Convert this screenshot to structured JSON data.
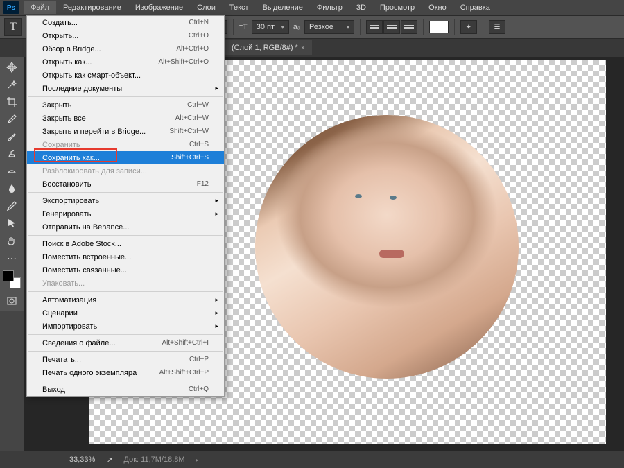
{
  "app": {
    "logo": "Ps"
  },
  "menubar": {
    "items": [
      "Файл",
      "Редактирование",
      "Изображение",
      "Слои",
      "Текст",
      "Выделение",
      "Фильтр",
      "3D",
      "Просмотр",
      "Окно",
      "Справка"
    ],
    "activeIndex": 0
  },
  "optionsbar": {
    "tool_glyph": "T",
    "font_size": "30 пт",
    "font_size_icon": "тТ",
    "aa_icon": "aₐ",
    "antialias": "Резкое",
    "color_swatch": "#ffffff"
  },
  "tab": {
    "label": "(Слой 1, RGB/8#) *"
  },
  "file_menu": {
    "groups": [
      [
        {
          "label": "Создать...",
          "shortcut": "Ctrl+N",
          "disabled": false
        },
        {
          "label": "Открыть...",
          "shortcut": "Ctrl+O",
          "disabled": false
        },
        {
          "label": "Обзор в Bridge...",
          "shortcut": "Alt+Ctrl+O",
          "disabled": false
        },
        {
          "label": "Открыть как...",
          "shortcut": "Alt+Shift+Ctrl+O",
          "disabled": false
        },
        {
          "label": "Открыть как смарт-объект...",
          "shortcut": "",
          "disabled": false
        },
        {
          "label": "Последние документы",
          "shortcut": "",
          "disabled": false,
          "submenu": true
        }
      ],
      [
        {
          "label": "Закрыть",
          "shortcut": "Ctrl+W",
          "disabled": false
        },
        {
          "label": "Закрыть все",
          "shortcut": "Alt+Ctrl+W",
          "disabled": false
        },
        {
          "label": "Закрыть и перейти в Bridge...",
          "shortcut": "Shift+Ctrl+W",
          "disabled": false
        },
        {
          "label": "Сохранить",
          "shortcut": "Ctrl+S",
          "disabled": true
        },
        {
          "label": "Сохранить как...",
          "shortcut": "Shift+Ctrl+S",
          "disabled": false,
          "highlighted": true
        },
        {
          "label": "Разблокировать для записи...",
          "shortcut": "",
          "disabled": true
        },
        {
          "label": "Восстановить",
          "shortcut": "F12",
          "disabled": false
        }
      ],
      [
        {
          "label": "Экспортировать",
          "shortcut": "",
          "disabled": false,
          "submenu": true
        },
        {
          "label": "Генерировать",
          "shortcut": "",
          "disabled": false,
          "submenu": true
        },
        {
          "label": "Отправить на Behance...",
          "shortcut": "",
          "disabled": false
        }
      ],
      [
        {
          "label": "Поиск в Adobe Stock...",
          "shortcut": "",
          "disabled": false
        },
        {
          "label": "Поместить встроенные...",
          "shortcut": "",
          "disabled": false
        },
        {
          "label": "Поместить связанные...",
          "shortcut": "",
          "disabled": false
        },
        {
          "label": "Упаковать...",
          "shortcut": "",
          "disabled": true
        }
      ],
      [
        {
          "label": "Автоматизация",
          "shortcut": "",
          "disabled": false,
          "submenu": true
        },
        {
          "label": "Сценарии",
          "shortcut": "",
          "disabled": false,
          "submenu": true
        },
        {
          "label": "Импортировать",
          "shortcut": "",
          "disabled": false,
          "submenu": true
        }
      ],
      [
        {
          "label": "Сведения о файле...",
          "shortcut": "Alt+Shift+Ctrl+I",
          "disabled": false
        }
      ],
      [
        {
          "label": "Печатать...",
          "shortcut": "Ctrl+P",
          "disabled": false
        },
        {
          "label": "Печать одного экземпляра",
          "shortcut": "Alt+Shift+Ctrl+P",
          "disabled": false
        }
      ],
      [
        {
          "label": "Выход",
          "shortcut": "Ctrl+Q",
          "disabled": false
        }
      ]
    ]
  },
  "statusbar": {
    "zoom": "33,33%",
    "doc": "Док: 11,7M/18,8M"
  },
  "toolbar_tools": [
    "move-tool",
    "magic-wand-tool",
    "crop-tool",
    "eyedropper-tool",
    "brush-tool",
    "clone-stamp-tool",
    "gradient-tool",
    "blur-tool",
    "pen-tool",
    "path-selection-tool",
    "hand-tool"
  ]
}
